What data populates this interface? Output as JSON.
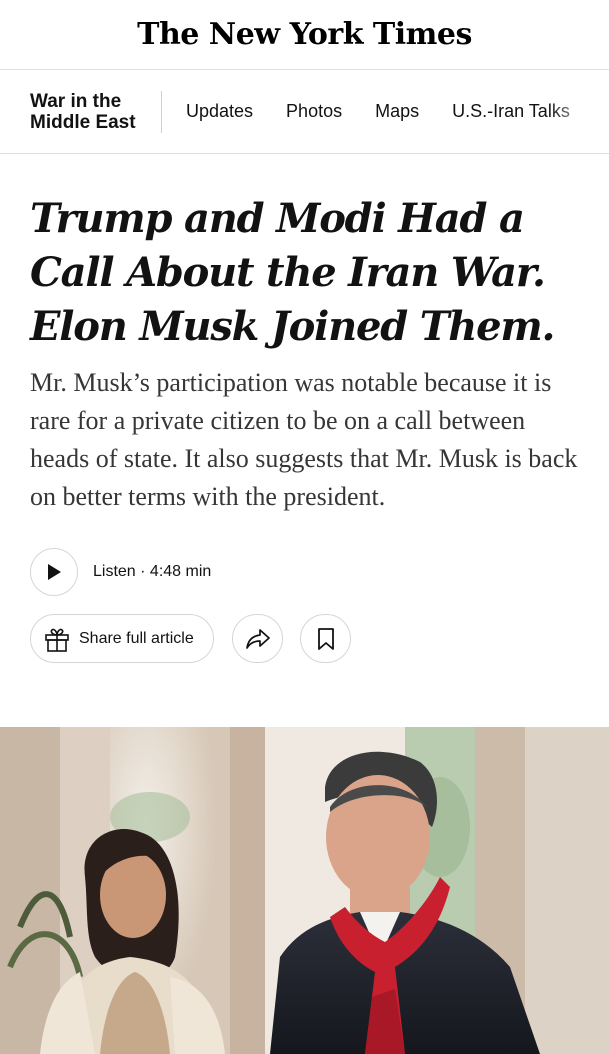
{
  "masthead": {
    "title": "The New York Times"
  },
  "section_nav": {
    "section_label_line1": "War in the",
    "section_label_line2": "Middle East",
    "items": [
      "Updates",
      "Photos",
      "Maps",
      "U.S.-Iran Talks"
    ]
  },
  "article": {
    "headline": "Trump and Modi Had a Call About the Iran War. Elon Musk Joined Them.",
    "summary": "Mr. Musk’s participation was notable because it is rare for a private citizen to be on a call between heads of state. It also suggests that Mr. Musk is back on better terms with the president.",
    "listen_label": "Listen · 4:48 min",
    "share_label": "Share full article"
  },
  "icons": {
    "play": "play-icon",
    "gift": "gift-icon",
    "share": "share-arrow-icon",
    "bookmark": "bookmark-icon"
  }
}
